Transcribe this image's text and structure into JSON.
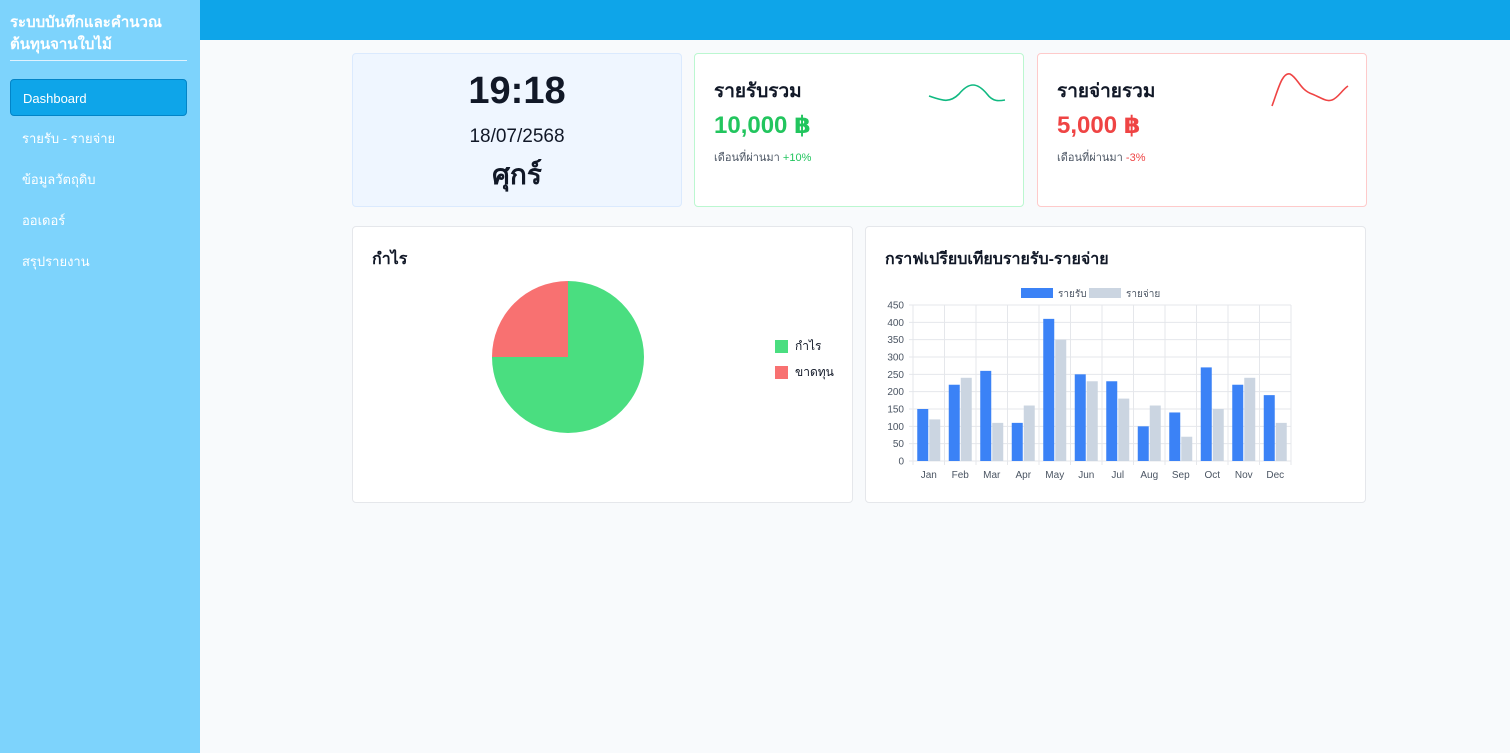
{
  "sidebar": {
    "brand": "ระบบบันทึกและคำนวณต้นทุนจานใบไม้",
    "items": [
      {
        "label": "Dashboard",
        "active": true
      },
      {
        "label": "รายรับ - รายจ่าย"
      },
      {
        "label": "ข้อมูลวัตถุดิบ"
      },
      {
        "label": "ออเดอร์"
      },
      {
        "label": "สรุปรายงาน"
      }
    ]
  },
  "clock": {
    "time": "19:18",
    "date": "18/07/2568",
    "day": "ศุกร์"
  },
  "income": {
    "title": "รายรับรวม",
    "value": "10,000 ฿",
    "note": "เดือนที่ผ่านมา",
    "change": "+10%",
    "color": "#22c55e"
  },
  "expense": {
    "title": "รายจ่ายรวม",
    "value": "5,000 ฿",
    "note": "เดือนที่ผ่านมา",
    "change": "-3%",
    "color": "#ef4444"
  },
  "profit_panel": {
    "title": "กำไร"
  },
  "compare_panel": {
    "title": "กราฟเปรียบเทียบรายรับ-รายจ่าย"
  },
  "colors": {
    "sidebar": "#7dd3fc",
    "topbar": "#0ea5e9",
    "income_bar": "#3b82f6",
    "expense_bar": "#cbd5e1",
    "profit": "#4ade80",
    "loss": "#f87171"
  },
  "chart_data": [
    {
      "type": "pie",
      "labels": [
        "กำไร",
        "ขาดทุน"
      ],
      "values": [
        75,
        25
      ],
      "colors": [
        "#4ade80",
        "#f87171"
      ],
      "legend": "right"
    },
    {
      "type": "bar",
      "categories": [
        "Jan",
        "Feb",
        "Mar",
        "Apr",
        "May",
        "Jun",
        "Jul",
        "Aug",
        "Sep",
        "Oct",
        "Nov",
        "Dec"
      ],
      "series": [
        {
          "name": "รายรับ",
          "color": "#3b82f6",
          "values": [
            150,
            220,
            260,
            110,
            410,
            250,
            230,
            100,
            140,
            270,
            220,
            190
          ]
        },
        {
          "name": "รายจ่าย",
          "color": "#cbd5e1",
          "values": [
            120,
            240,
            110,
            160,
            350,
            230,
            180,
            160,
            70,
            150,
            240,
            110
          ]
        }
      ],
      "ylim": [
        0,
        450
      ],
      "yticks": [
        0,
        50,
        100,
        150,
        200,
        250,
        300,
        350,
        400,
        450
      ],
      "grid": true,
      "legend": "top"
    }
  ]
}
